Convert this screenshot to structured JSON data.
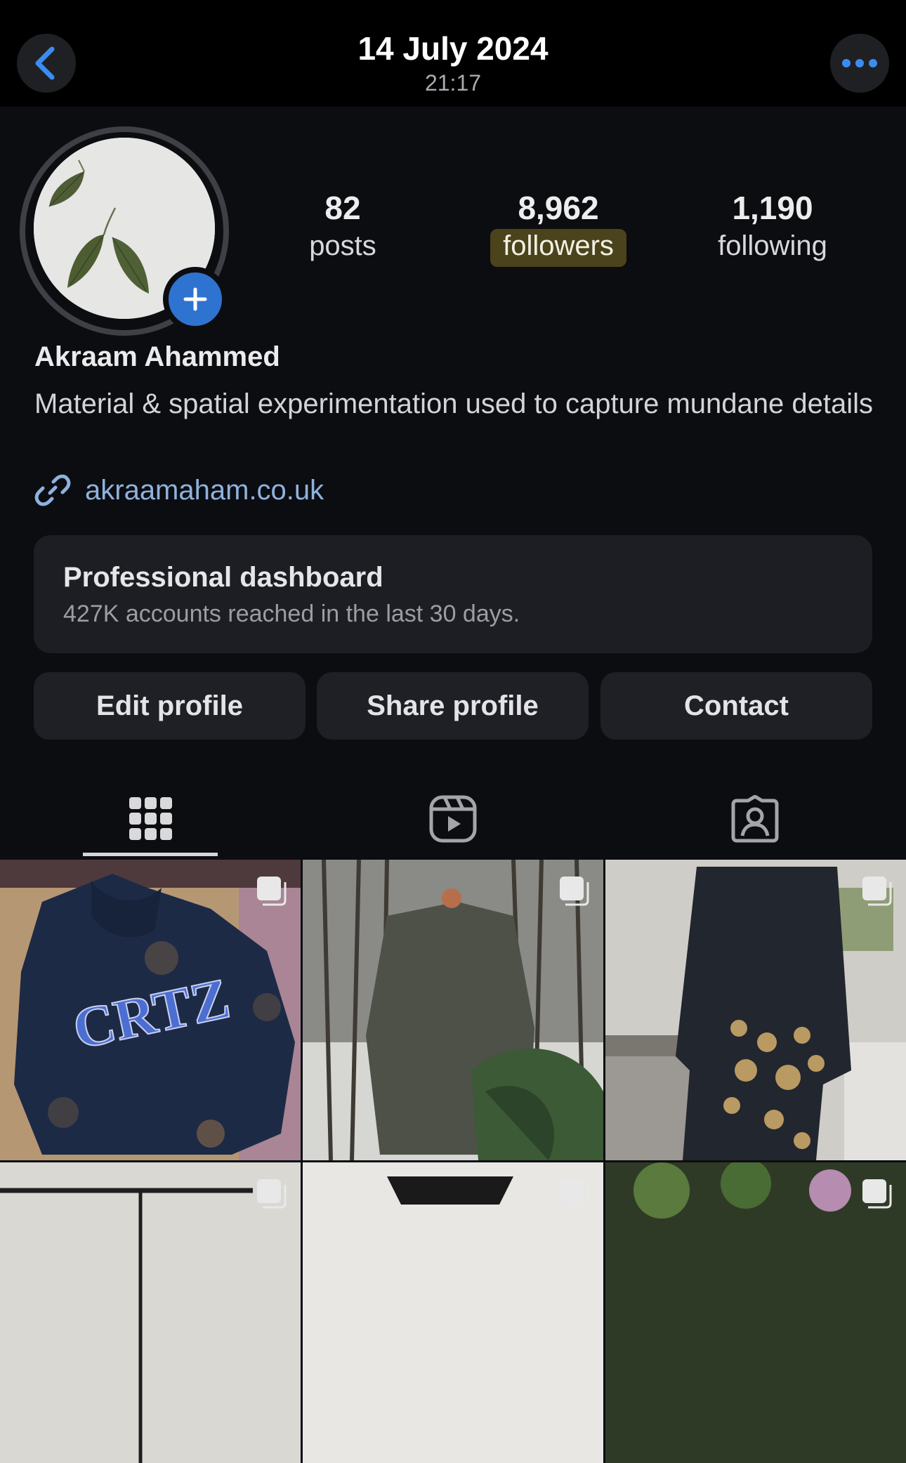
{
  "header": {
    "date": "14 July 2024",
    "time": "21:17"
  },
  "colors": {
    "accent": "#2f73d0",
    "link": "#8fb2dd",
    "highlight": "#4a431c"
  },
  "profile": {
    "stats": [
      {
        "value": "82",
        "label": "posts"
      },
      {
        "value": "8,962",
        "label": "followers"
      },
      {
        "value": "1,190",
        "label": "following"
      }
    ],
    "name": "Akraam Ahammed",
    "bio": "Material & spatial experimentation used to capture mundane details",
    "link": "akraamaham.co.uk"
  },
  "dashboard": {
    "title": "Professional dashboard",
    "subtitle": "427K accounts reached in the last 30 days."
  },
  "buttons": {
    "edit": "Edit profile",
    "share": "Share profile",
    "contact": "Contact"
  },
  "tabs": [
    {
      "icon": "grid-icon",
      "active": true
    },
    {
      "icon": "reels-icon",
      "active": false
    },
    {
      "icon": "tagged-icon",
      "active": false
    }
  ]
}
